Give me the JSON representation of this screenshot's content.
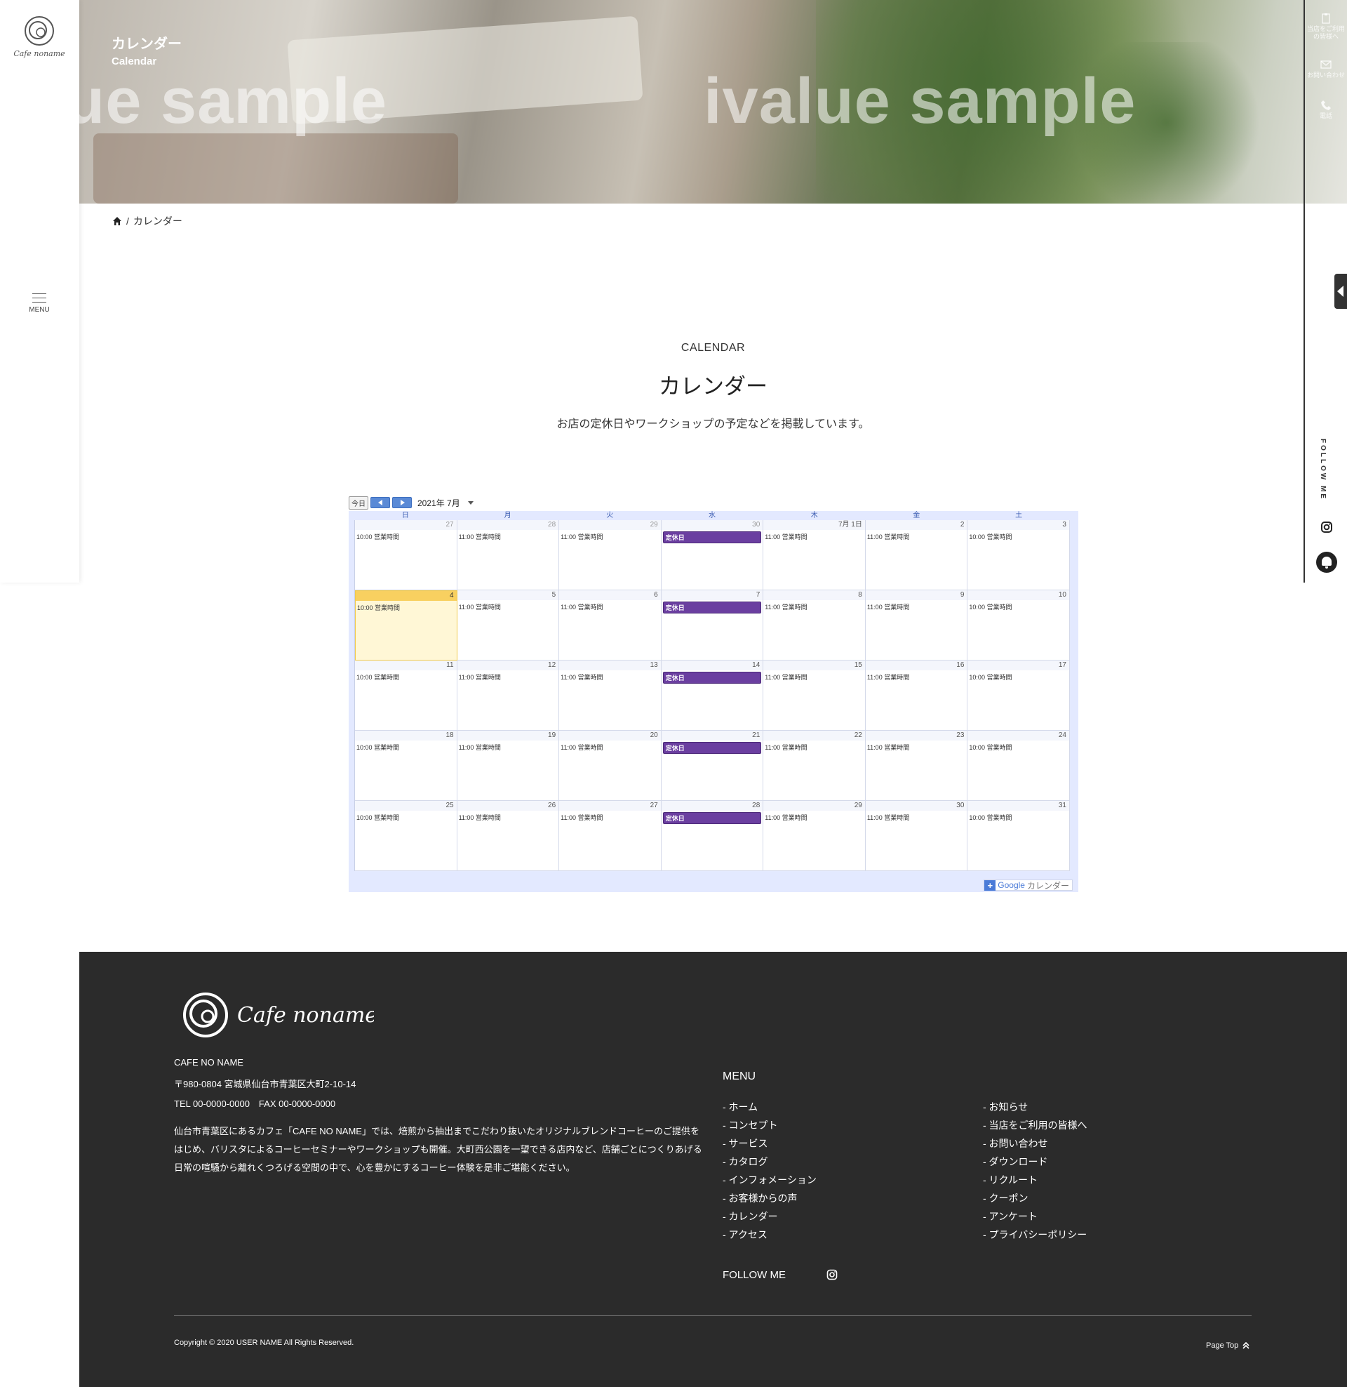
{
  "brand": {
    "logo_text": "Cafe noname"
  },
  "hero": {
    "title_ja": "カレンダー",
    "title_en": "Calendar",
    "watermark_left": "ue sample",
    "watermark_right": "ivalue sample"
  },
  "sidebar": {
    "menu_label": "MENU"
  },
  "right_rail": {
    "item1": "当店をご利用の皆様へ",
    "item2": "お問い合わせ",
    "item3": "電話",
    "follow_label": "FOLLOW ME"
  },
  "breadcrumb": {
    "current": "カレンダー",
    "separator": "/"
  },
  "section": {
    "title_en": "CALENDAR",
    "title_ja": "カレンダー",
    "description": "お店の定休日やワークショップの予定などを掲載しています。"
  },
  "calendar": {
    "today_label": "今日",
    "month_label": "2021年 7月",
    "weekdays": [
      "日",
      "月",
      "火",
      "水",
      "木",
      "金",
      "土"
    ],
    "weeks": [
      [
        {
          "d": "27",
          "o": true,
          "e": "10:00 営業時間"
        },
        {
          "d": "28",
          "o": true,
          "e": "11:00 営業時間"
        },
        {
          "d": "29",
          "o": true,
          "e": "11:00 営業時間"
        },
        {
          "d": "30",
          "o": true,
          "e": "定休日",
          "h": true
        },
        {
          "d": "7月 1日",
          "e": "11:00 営業時間"
        },
        {
          "d": "2",
          "e": "11:00 営業時間"
        },
        {
          "d": "3",
          "e": "10:00 営業時間"
        }
      ],
      [
        {
          "d": "4",
          "t": true,
          "e": "10:00 営業時間"
        },
        {
          "d": "5",
          "e": "11:00 営業時間"
        },
        {
          "d": "6",
          "e": "11:00 営業時間"
        },
        {
          "d": "7",
          "e": "定休日",
          "h": true
        },
        {
          "d": "8",
          "e": "11:00 営業時間"
        },
        {
          "d": "9",
          "e": "11:00 営業時間"
        },
        {
          "d": "10",
          "e": "10:00 営業時間"
        }
      ],
      [
        {
          "d": "11",
          "e": "10:00 営業時間"
        },
        {
          "d": "12",
          "e": "11:00 営業時間"
        },
        {
          "d": "13",
          "e": "11:00 営業時間"
        },
        {
          "d": "14",
          "e": "定休日",
          "h": true
        },
        {
          "d": "15",
          "e": "11:00 営業時間"
        },
        {
          "d": "16",
          "e": "11:00 営業時間"
        },
        {
          "d": "17",
          "e": "10:00 営業時間"
        }
      ],
      [
        {
          "d": "18",
          "e": "10:00 営業時間"
        },
        {
          "d": "19",
          "e": "11:00 営業時間"
        },
        {
          "d": "20",
          "e": "11:00 営業時間"
        },
        {
          "d": "21",
          "e": "定休日",
          "h": true
        },
        {
          "d": "22",
          "e": "11:00 営業時間"
        },
        {
          "d": "23",
          "e": "11:00 営業時間"
        },
        {
          "d": "24",
          "e": "10:00 営業時間"
        }
      ],
      [
        {
          "d": "25",
          "e": "10:00 営業時間"
        },
        {
          "d": "26",
          "e": "11:00 営業時間"
        },
        {
          "d": "27",
          "e": "11:00 営業時間"
        },
        {
          "d": "28",
          "e": "定休日",
          "h": true
        },
        {
          "d": "29",
          "e": "11:00 営業時間"
        },
        {
          "d": "30",
          "e": "11:00 営業時間"
        },
        {
          "d": "31",
          "e": "10:00 営業時間"
        }
      ]
    ],
    "google_label_g": "Google",
    "google_label_cal": "カレンダー"
  },
  "footer": {
    "company": "CAFE NO NAME",
    "address": "〒980-0804  宮城県仙台市青葉区大町2-10-14",
    "tel": "TEL 00-0000-0000　FAX 00-0000-0000",
    "description": "仙台市青葉区にあるカフェ「CAFE NO NAME」では、焙煎から抽出までこだわり抜いたオリジナルブレンドコーヒーのご提供をはじめ、バリスタによるコーヒーセミナーやワークショップも開催。大町西公園を一望できる店内など、店舗ごとにつくりあげる日常の喧騒から離れくつろげる空間の中で、心を豊かにするコーヒー体験を是非ご堪能ください。",
    "menu_heading": "MENU",
    "menu_col1": [
      "- ホーム",
      "- コンセプト",
      "- サービス",
      "- カタログ",
      "- インフォメーション",
      "- お客様からの声",
      "- カレンダー",
      "- アクセス"
    ],
    "menu_col2": [
      "- お知らせ",
      "- 当店をご利用の皆様へ",
      "- お問い合わせ",
      "- ダウンロード",
      "- リクルート",
      "- クーポン",
      "- アンケート",
      "- プライバシーポリシー"
    ],
    "follow_label": "FOLLOW ME",
    "copyright": "Copyright © 2020 USER NAME All Rights Reserved.",
    "page_top": "Page Top"
  }
}
